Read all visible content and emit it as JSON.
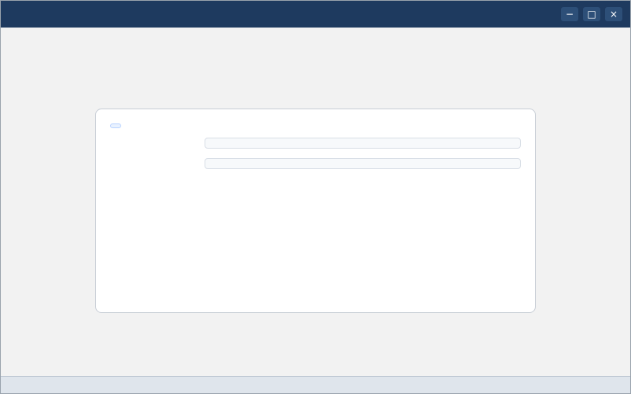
{
  "window": {
    "title": "",
    "controls": {
      "min": "−",
      "max": "□",
      "close": "×"
    }
  },
  "panel": {
    "header_badge": "",
    "row1_label": "",
    "row1_value": "",
    "row2_label": "",
    "row2_value": "",
    "note": ""
  },
  "status": {
    "text": ""
  }
}
